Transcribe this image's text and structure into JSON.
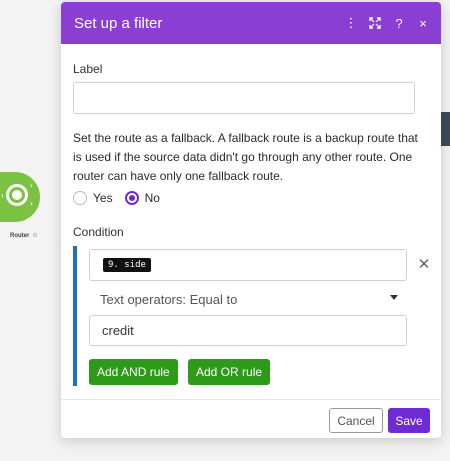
{
  "dialog": {
    "title": "Set up a filter",
    "header_icons": [
      "more-vertical-icon",
      "expand-icon",
      "help-icon",
      "close-icon"
    ]
  },
  "label_field": {
    "label": "Label",
    "value": "",
    "placeholder": ""
  },
  "fallback": {
    "description": "Set the route as a fallback. A fallback route is a backup route that is used if the source data didn't go through any other route. One router can have only one fallback route.",
    "options": [
      "Yes",
      "No"
    ],
    "selected": "No"
  },
  "condition": {
    "label": "Condition",
    "operand1_pill": "9. side",
    "operator": "Text operators: Equal to",
    "operand2_value": "credit",
    "add_and_label": "Add AND rule",
    "add_or_label": "Add OR rule"
  },
  "footer": {
    "cancel_label": "Cancel",
    "save_label": "Save"
  },
  "canvas": {
    "router_label": "Router",
    "router_color": "#7cc242",
    "hub_color": "#3d4b5b"
  },
  "colors": {
    "header": "#8a3fd2",
    "accent": "#6e2bd4",
    "rule_button": "#2e9a1a",
    "condition_bar": "#1e6fbf"
  }
}
